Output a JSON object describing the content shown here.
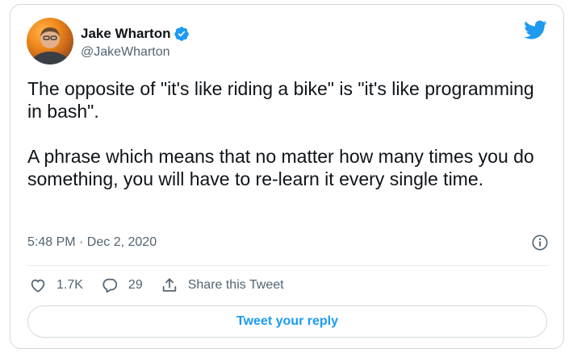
{
  "author": {
    "name": "Jake Wharton",
    "handle": "@JakeWharton",
    "verified": true
  },
  "tweet": {
    "paragraphs": [
      "The opposite of \"it's like riding a bike\" is \"it's like programming in bash\".",
      "A phrase which means that no matter how many times you do something, you will have to re-learn it every single time."
    ],
    "timestamp": "5:48 PM · Dec 2, 2020"
  },
  "actions": {
    "likes": "1.7K",
    "replies": "29",
    "share_label": "Share this Tweet"
  },
  "reply_button_label": "Tweet your reply",
  "icons": {
    "brand": "twitter-bird-icon",
    "verified": "verified-badge-icon",
    "info": "info-icon",
    "like": "heart-icon",
    "reply": "reply-bubble-icon",
    "share": "share-icon"
  },
  "colors": {
    "accent": "#1d9bf0",
    "text": "#0f1419",
    "secondary_text": "#536471",
    "border": "#cfd9de"
  }
}
